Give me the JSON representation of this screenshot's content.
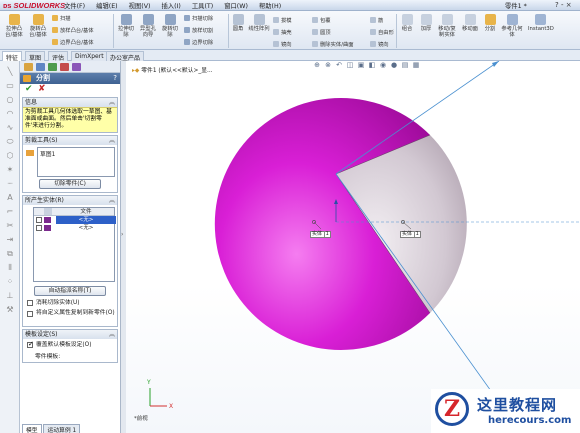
{
  "app": {
    "logo_text": "SOLIDWORKS",
    "menu": [
      "文件(F)",
      "编辑(E)",
      "视图(V)",
      "插入(I)",
      "工具(T)",
      "窗口(W)",
      "帮助(H)"
    ],
    "doc_title": "零件1 *",
    "window_controls": "?  -  ×"
  },
  "ribbon": {
    "large_buttons": [
      {
        "label": "拉伸凸台/基体",
        "icon": "extrude-boss-icon"
      },
      {
        "label": "旋转凸台/基体",
        "icon": "revolve-boss-icon"
      },
      {
        "label": "拉伸切除",
        "icon": "extrude-cut-icon"
      },
      {
        "label": "异型孔向导",
        "icon": "hole-wizard-icon"
      },
      {
        "label": "旋转切除",
        "icon": "revolve-cut-icon"
      },
      {
        "label": "圆角",
        "icon": "fillet-icon"
      },
      {
        "label": "线性阵列",
        "icon": "linear-pattern-icon"
      },
      {
        "label": "筋",
        "icon": "rib-icon"
      },
      {
        "label": "包覆",
        "icon": "wrap-icon"
      },
      {
        "label": "组合",
        "icon": "combine-icon"
      },
      {
        "label": "加厚",
        "icon": "thicken-icon"
      },
      {
        "label": "移动/复制实体",
        "icon": "move-copy-icon"
      },
      {
        "label": "移动面",
        "icon": "move-face-icon"
      },
      {
        "label": "分割",
        "icon": "split-icon"
      },
      {
        "label": "参考几何体",
        "icon": "ref-geometry-icon"
      },
      {
        "label": "Instant3D",
        "icon": "instant3d-icon"
      }
    ],
    "small_buttons": [
      {
        "label": "扫描"
      },
      {
        "label": "放样凸台/基体"
      },
      {
        "label": "边界凸台/基体"
      },
      {
        "label": "扫描切除"
      },
      {
        "label": "放样切割"
      },
      {
        "label": "边界切除"
      },
      {
        "label": "拔模"
      },
      {
        "label": "抽壳"
      },
      {
        "label": "镜向"
      },
      {
        "label": "圆顶"
      },
      {
        "label": "自由形"
      },
      {
        "label": "删除/保持实体"
      },
      {
        "label": "删除实体/曲面"
      }
    ]
  },
  "tabs": [
    "特征",
    "草图",
    "评估",
    "DimXpert",
    "办公室产品"
  ],
  "property_manager": {
    "title": "分割",
    "help": "?",
    "ok": "✔",
    "cancel": "✘",
    "message_header": "信息",
    "message": "为剪裁工具几何体选取一草图、基准面或曲面。然后单击'切割零件'来进行分割。",
    "trim_tools_header": "剪裁工具(S)",
    "trim_tool_item": "草图1",
    "cut_part_button": "切除零件(C)",
    "bodies_header": "所产生实体(R)",
    "table_header": [
      "文件"
    ],
    "table_rows": [
      "<无>",
      "<无>"
    ],
    "auto_assign_button": "自动指派名称(T)",
    "consume_option": "消耗切除实体(U)",
    "propagate_option": "将自定义属性复制到新零件(O)",
    "template_header": "模板设定(S)",
    "override_option": "覆盖默认模板设定(O)",
    "part_template_label": "零件模板:"
  },
  "viewport": {
    "breadcrumb": "零件1 (默认<<默认>_显...",
    "dims": [
      "实体",
      "实体"
    ],
    "axis_label": "*前视",
    "watermark_cn": "这里教程网",
    "watermark_url": "herecours.com"
  },
  "bottom_tabs": [
    "模型",
    "运动算例 1"
  ]
}
